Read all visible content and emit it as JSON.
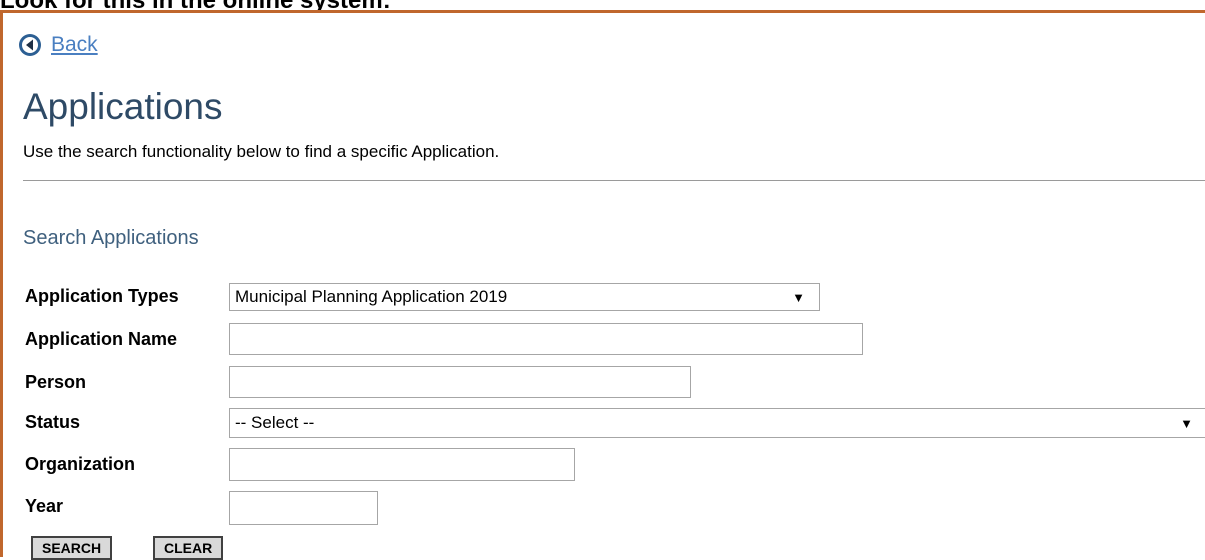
{
  "caption": "Look for this in the online system:",
  "nav": {
    "back_label": "Back",
    "back_icon": "back-arrow-circle-icon"
  },
  "page": {
    "title": "Applications",
    "description": "Use the search functionality below to find a specific Application."
  },
  "search": {
    "section_title": "Search Applications",
    "labels": {
      "application_types": "Application Types",
      "application_name": "Application Name",
      "person": "Person",
      "status": "Status",
      "organization": "Organization",
      "year": "Year"
    },
    "values": {
      "application_types": "Municipal Planning Application 2019",
      "application_name": "",
      "person": "",
      "status": "-- Select --",
      "organization": "",
      "year": ""
    },
    "buttons": {
      "search": "SEARCH",
      "clear": "CLEAR"
    }
  },
  "colors": {
    "frame_border": "#c0672d",
    "link": "#4a7fc1",
    "title": "#2e4a66",
    "section_title": "#3f607e",
    "button_bg": "#d9d9d9"
  }
}
